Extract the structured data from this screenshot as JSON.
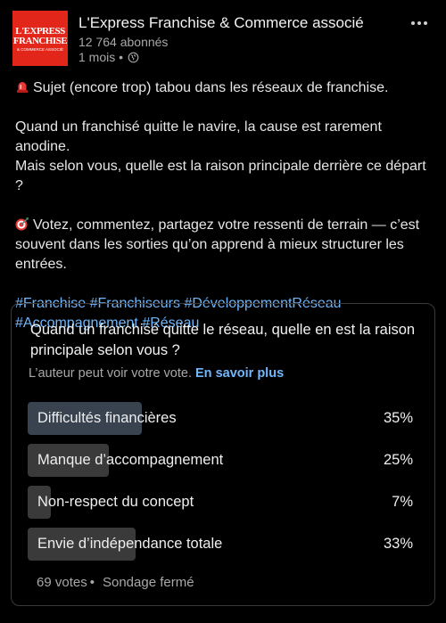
{
  "post": {
    "author": {
      "logo_line1": "L'EXPRESS",
      "logo_line2": "FRANCHISE",
      "logo_line3": "& COMMERCE ASSOCIÉ",
      "name": "L'Express Franchise & Commerce associé",
      "followers": "12 764 abonnés",
      "time": "1 mois •"
    },
    "line1": "Sujet (encore trop) tabou dans les réseaux de franchise.",
    "para2_line1": "Quand un franchisé quitte le navire, la cause est rarement anodine.",
    "para2_line2": "Mais selon vous, quelle est la raison principale derrière ce départ ?",
    "para3": "Votez, commentez, partagez votre ressenti de terrain — c’est souvent dans les sorties qu’on apprend à mieux structurer les entrées.",
    "hashtags": [
      "#Franchise",
      "#Franchiseurs",
      "#DéveloppementRéseau",
      "#Accompagnement",
      "#Réseau"
    ]
  },
  "poll": {
    "question": "Quand un franchisé quitte le réseau, quelle en est la raison principale selon vous ?",
    "note": "L’auteur peut voir votre vote.",
    "learn_more": "En savoir plus",
    "options": [
      {
        "label": "Difficultés financières",
        "percent": "35%",
        "value": 35
      },
      {
        "label": "Manque d’accompagnement",
        "percent": "25%",
        "value": 25
      },
      {
        "label": "Non-respect du concept",
        "percent": "7%",
        "value": 7
      },
      {
        "label": "Envie d’indépendance totale",
        "percent": "33%",
        "value": 33
      }
    ],
    "votes": "69 votes",
    "separator": "•",
    "status": "Sondage fermé"
  },
  "colors": {
    "background": "#000000",
    "link": "#71b7fb",
    "logo_red": "#e3261a",
    "bar_selected": "#38434f",
    "bar": "#3a3a3a"
  },
  "icons": [
    "siren-emoji",
    "target-emoji",
    "globe-icon",
    "more-icon"
  ]
}
